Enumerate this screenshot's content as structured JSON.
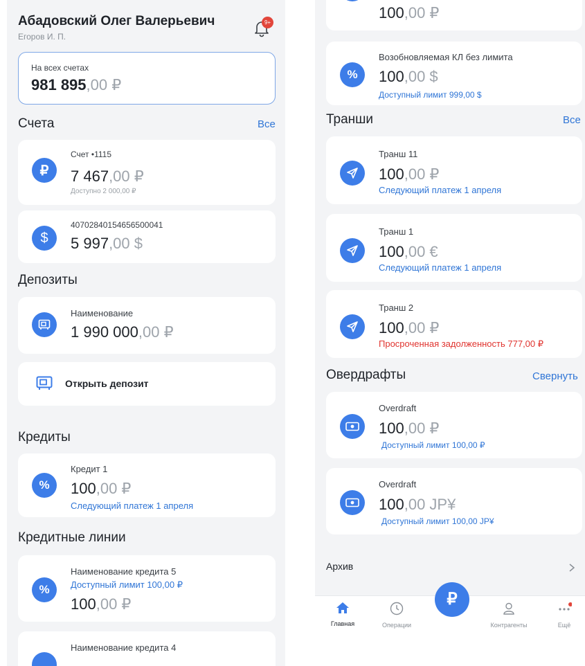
{
  "colors": {
    "accent": "#3d7de8",
    "link": "#2f75d6",
    "danger": "#e0332e",
    "background": "#f3f4f6"
  },
  "left": {
    "user_name": "Абадовский Олег Валерьевич",
    "user_sub": "Егоров И. П.",
    "notification_badge": "9+",
    "total": {
      "label": "На всех счетах",
      "int": "981 895",
      "frac": ",00 ₽"
    },
    "accounts": {
      "title": "Счета",
      "all_link": "Все",
      "items": [
        {
          "icon": "ruble-icon",
          "name": "Счет •1115",
          "int": "7 467",
          "frac": ",00 ₽",
          "sub": "Доступно 2 000,00 ₽"
        },
        {
          "icon": "dollar-icon",
          "name": "40702840154656500041",
          "int": "5 997",
          "frac": ",00 $"
        }
      ]
    },
    "deposits": {
      "title": "Депозиты",
      "items": [
        {
          "icon": "safe-icon",
          "name": "Наименование",
          "int": "1 990 000",
          "frac": ",00 ₽"
        }
      ],
      "open_label": "Открыть депозит"
    },
    "credits": {
      "title": "Кредиты",
      "items": [
        {
          "icon": "percent-icon",
          "name": "Кредит 1",
          "int": "100",
          "frac": ",00 ₽",
          "sub": "Следующий платеж 1 апреля"
        }
      ]
    },
    "credit_lines": {
      "title": "Кредитные линии",
      "items": [
        {
          "icon": "percent-icon",
          "name": "Наименование кредита 5",
          "sub": "Доступный лимит 100,00 ₽",
          "int": "100",
          "frac": ",00 ₽"
        },
        {
          "icon": "percent-icon",
          "name": "Наименование кредита 4"
        }
      ]
    }
  },
  "right": {
    "top_partial": {
      "int": "100",
      "frac": ",00 ₽"
    },
    "renewable": {
      "icon": "percent-icon",
      "name": "Возобновляемая КЛ без лимита",
      "int": "100",
      "frac": ",00 $",
      "sub": "Доступный лимит 999,00 $"
    },
    "tranches": {
      "title": "Транши",
      "all_link": "Все",
      "items": [
        {
          "icon": "send-icon",
          "name": "Транш 11",
          "int": "100",
          "frac": ",00 ₽",
          "sub": "Следующий платеж 1 апреля"
        },
        {
          "icon": "send-icon",
          "name": "Транш 1",
          "int": "100",
          "frac": ",00 €",
          "sub": "Следующий платеж 1 апреля"
        },
        {
          "icon": "send-icon",
          "name": "Транш 2",
          "int": "100",
          "frac": ",00 ₽",
          "sub": "Просроченная задолженность 777,00 ₽"
        }
      ]
    },
    "overdrafts": {
      "title": "Овердрафты",
      "collapse_link": "Свернуть",
      "items": [
        {
          "icon": "cash-icon",
          "name": "Overdraft",
          "int": "100",
          "frac": ",00 ₽",
          "sub": "Доступный лимит 100,00 ₽"
        },
        {
          "icon": "cash-icon",
          "name": "Overdraft",
          "int": "100",
          "frac": ",00 JP¥",
          "sub": "Доступный лимит 100,00 JP¥"
        }
      ]
    },
    "archive_label": "Архив",
    "tabbar": {
      "home": "Главная",
      "operations": "Операции",
      "center_symbol": "₽",
      "contractors": "Контрагенты",
      "more": "Ещё"
    }
  }
}
